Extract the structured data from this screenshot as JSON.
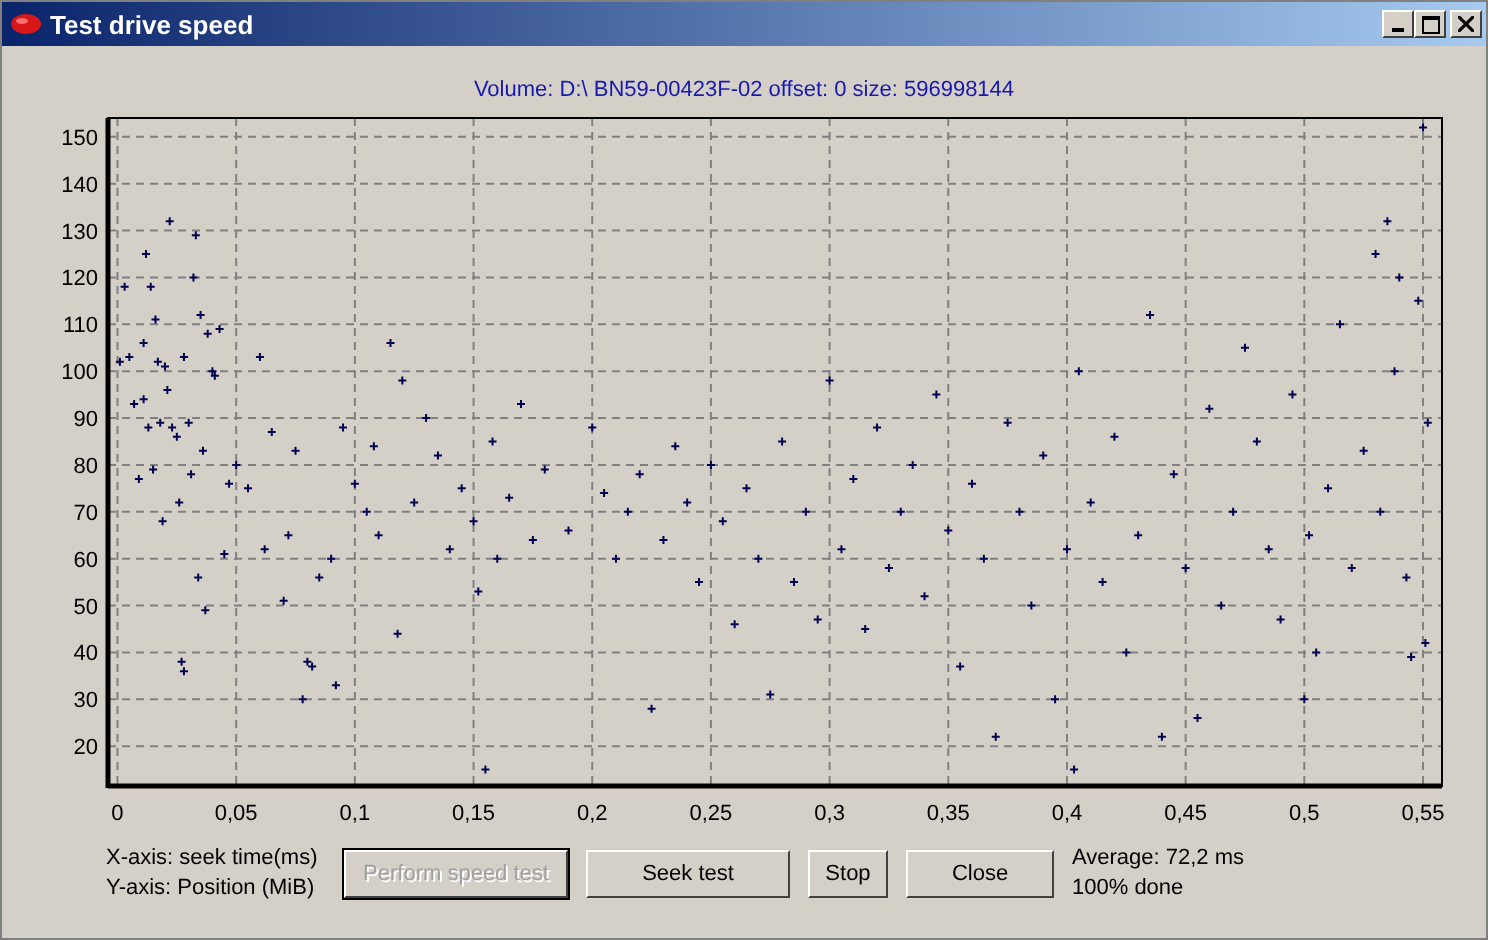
{
  "window": {
    "title": "Test drive speed"
  },
  "subtitle": "Volume: D:\\ BN59-00423F-02 offset: 0 size: 596998144",
  "chart": {
    "chart_data": {
      "type": "scatter",
      "x": [
        0.001,
        0.003,
        0.005,
        0.007,
        0.009,
        0.011,
        0.011,
        0.012,
        0.013,
        0.014,
        0.015,
        0.016,
        0.017,
        0.018,
        0.019,
        0.02,
        0.021,
        0.022,
        0.023,
        0.025,
        0.026,
        0.027,
        0.028,
        0.028,
        0.03,
        0.031,
        0.032,
        0.033,
        0.034,
        0.035,
        0.036,
        0.037,
        0.038,
        0.04,
        0.041,
        0.043,
        0.045,
        0.047,
        0.05,
        0.055,
        0.06,
        0.062,
        0.065,
        0.07,
        0.072,
        0.075,
        0.078,
        0.08,
        0.082,
        0.085,
        0.09,
        0.092,
        0.095,
        0.1,
        0.105,
        0.108,
        0.11,
        0.115,
        0.118,
        0.12,
        0.125,
        0.13,
        0.135,
        0.14,
        0.145,
        0.15,
        0.152,
        0.155,
        0.158,
        0.16,
        0.165,
        0.17,
        0.175,
        0.18,
        0.19,
        0.2,
        0.205,
        0.21,
        0.215,
        0.22,
        0.225,
        0.23,
        0.235,
        0.24,
        0.245,
        0.25,
        0.255,
        0.26,
        0.265,
        0.27,
        0.275,
        0.28,
        0.285,
        0.29,
        0.295,
        0.3,
        0.305,
        0.31,
        0.315,
        0.32,
        0.325,
        0.33,
        0.335,
        0.34,
        0.345,
        0.35,
        0.355,
        0.36,
        0.365,
        0.37,
        0.375,
        0.38,
        0.385,
        0.39,
        0.395,
        0.4,
        0.403,
        0.405,
        0.41,
        0.415,
        0.42,
        0.425,
        0.43,
        0.435,
        0.44,
        0.445,
        0.45,
        0.455,
        0.46,
        0.465,
        0.47,
        0.475,
        0.48,
        0.485,
        0.49,
        0.495,
        0.5,
        0.502,
        0.505,
        0.51,
        0.515,
        0.52,
        0.525,
        0.53,
        0.532,
        0.535,
        0.538,
        0.54,
        0.543,
        0.545,
        0.548,
        0.55,
        0.551,
        0.552
      ],
      "grid": true,
      "series": [
        {
          "color": "#000050",
          "values": [
            102,
            118,
            103,
            93,
            77,
            106,
            94,
            125,
            88,
            118,
            79,
            111,
            102,
            89,
            68,
            101,
            96,
            132,
            88,
            86,
            72,
            38,
            36,
            103,
            89,
            78,
            120,
            129,
            56,
            112,
            83,
            49,
            108,
            100,
            99,
            109,
            61,
            76,
            80,
            75,
            103,
            62,
            87,
            51,
            65,
            83,
            30,
            38,
            37,
            56,
            60,
            33,
            88,
            76,
            70,
            84,
            65,
            106,
            44,
            98,
            72,
            90,
            82,
            62,
            75,
            68,
            53,
            15,
            85,
            60,
            73,
            93,
            64,
            79,
            66,
            88,
            74,
            60,
            70,
            78,
            28,
            64,
            84,
            72,
            55,
            80,
            68,
            46,
            75,
            60,
            31,
            85,
            55,
            70,
            47,
            98,
            62,
            77,
            45,
            88,
            58,
            70,
            80,
            52,
            95,
            66,
            37,
            76,
            60,
            22,
            89,
            70,
            50,
            82,
            30,
            62,
            15,
            100,
            72,
            55,
            86,
            40,
            65,
            112,
            22,
            78,
            58,
            26,
            92,
            50,
            70,
            105,
            85,
            62,
            47,
            95,
            30,
            65,
            40,
            75,
            110,
            58,
            83,
            125,
            70,
            132,
            100,
            120,
            56,
            39,
            115,
            152,
            42,
            89
          ]
        }
      ],
      "xlim": [
        -0.004,
        0.558
      ],
      "ylim": [
        11.5,
        154
      ],
      "xticks": [
        {
          "value": 0,
          "label": "0"
        },
        {
          "value": 0.05,
          "label": "0,05"
        },
        {
          "value": 0.1,
          "label": "0,1"
        },
        {
          "value": 0.15,
          "label": "0,15"
        },
        {
          "value": 0.2,
          "label": "0,2"
        },
        {
          "value": 0.25,
          "label": "0,25"
        },
        {
          "value": 0.3,
          "label": "0,3"
        },
        {
          "value": 0.35,
          "label": "0,35"
        },
        {
          "value": 0.4,
          "label": "0,4"
        },
        {
          "value": 0.45,
          "label": "0,45"
        },
        {
          "value": 0.5,
          "label": "0,5"
        },
        {
          "value": 0.55,
          "label": "0,55"
        }
      ],
      "yticks": [
        20,
        30,
        40,
        50,
        60,
        70,
        80,
        90,
        100,
        110,
        120,
        130,
        140,
        150
      ]
    }
  },
  "axis_legend": [
    "X-axis: seek time(ms)",
    "Y-axis: Position (MiB)"
  ],
  "buttons": [
    {
      "label": "Perform speed test",
      "disabled": true,
      "default": true
    },
    {
      "label": "Seek test",
      "disabled": false,
      "default": false
    },
    {
      "label": "Stop",
      "disabled": false,
      "default": false
    },
    {
      "label": "Close",
      "disabled": false,
      "default": false
    }
  ],
  "status": [
    "Average: 72,2 ms",
    "100% done"
  ]
}
